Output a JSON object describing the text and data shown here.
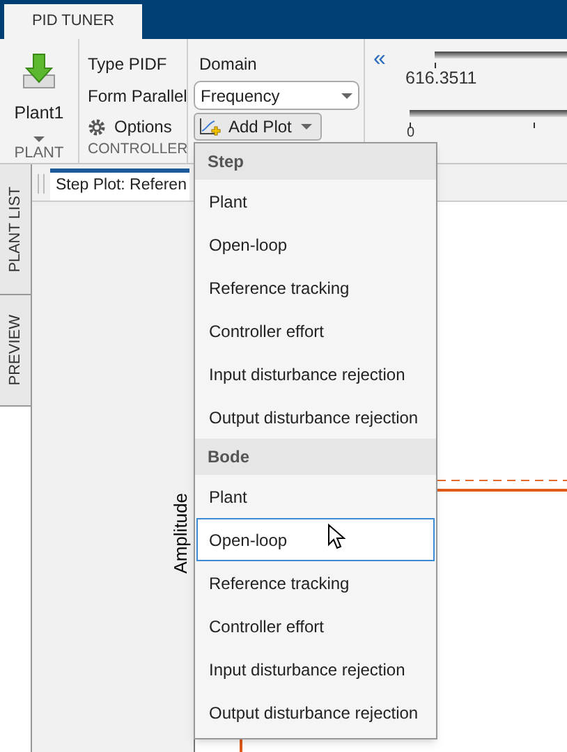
{
  "tabs": [
    {
      "label": "PID TUNER",
      "selected": true
    }
  ],
  "toolstrip": {
    "plant": {
      "button": "Plant1",
      "section": "PLANT"
    },
    "controller": {
      "type": "Type PIDF",
      "form": "Form Parallel",
      "options": "Options",
      "section": "CONTROLLER"
    },
    "domain": {
      "label": "Domain",
      "value": "Frequency",
      "add_plot": "Add Plot"
    },
    "collapse": "«",
    "sliders": [
      {
        "reading": "616.3511"
      },
      {
        "reading": "0"
      }
    ]
  },
  "side_tabs": [
    {
      "label": "PLANT LIST",
      "selected": false
    },
    {
      "label": "PREVIEW",
      "selected": false
    }
  ],
  "document_tab": {
    "label": "Step Plot: Referen",
    "selected": true
  },
  "plot": {
    "ylabel": "Amplitude"
  },
  "menu": [
    {
      "header": "Step",
      "items": [
        {
          "label": "Plant",
          "hovered": false
        },
        {
          "label": "Open-loop",
          "hovered": false
        },
        {
          "label": "Reference tracking",
          "hovered": false
        },
        {
          "label": "Controller effort",
          "hovered": false
        },
        {
          "label": "Input disturbance rejection",
          "hovered": false
        },
        {
          "label": "Output disturbance rejection",
          "hovered": false
        }
      ]
    },
    {
      "header": "Bode",
      "items": [
        {
          "label": "Plant",
          "hovered": false
        },
        {
          "label": "Open-loop",
          "hovered": true
        },
        {
          "label": "Reference tracking",
          "hovered": false
        },
        {
          "label": "Controller effort",
          "hovered": false
        },
        {
          "label": "Input disturbance rejection",
          "hovered": false
        },
        {
          "label": "Output disturbance rejection",
          "hovered": false
        }
      ]
    }
  ]
}
